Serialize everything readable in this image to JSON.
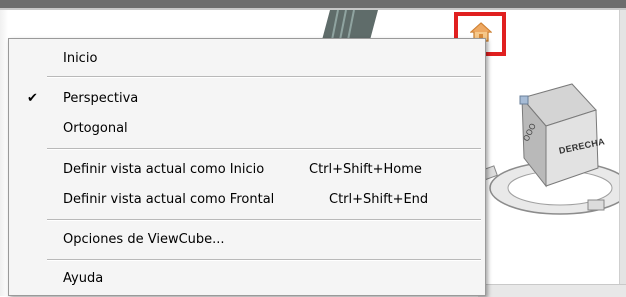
{
  "menu": {
    "items": [
      {
        "label": "Inicio",
        "checked": false,
        "shortcut": ""
      },
      {
        "label": "Perspectiva",
        "checked": true,
        "shortcut": ""
      },
      {
        "label": "Ortogonal",
        "checked": false,
        "shortcut": ""
      },
      {
        "label": "Definir vista actual como Inicio",
        "checked": false,
        "shortcut": "Ctrl+Shift+Home"
      },
      {
        "label": "Definir vista actual como Frontal",
        "checked": false,
        "shortcut": "Ctrl+Shift+End"
      },
      {
        "label": "Opciones de ViewCube...",
        "checked": false,
        "shortcut": ""
      },
      {
        "label": "Ayuda",
        "checked": false,
        "shortcut": ""
      }
    ],
    "check_glyph": "✔"
  },
  "viewcube": {
    "face_label": "DERECHA",
    "icon": "viewcube-icon"
  },
  "home_button": {
    "icon": "home-icon",
    "highlight_color": "#e02020"
  }
}
